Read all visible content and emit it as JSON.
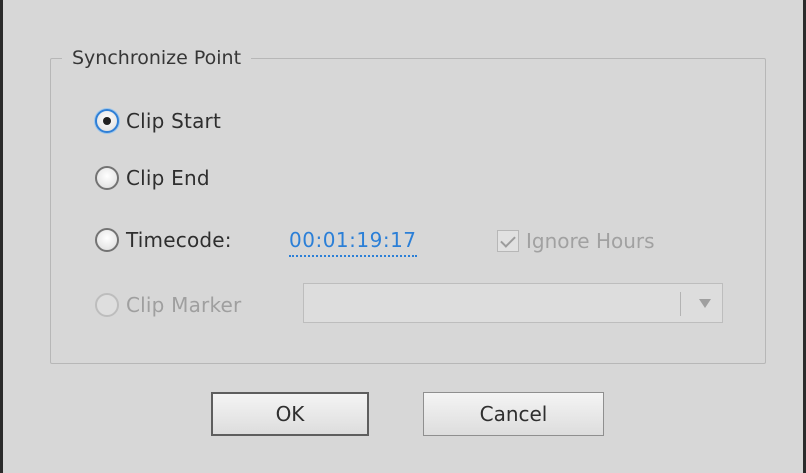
{
  "dialog": {
    "group_title": "Synchronize Point",
    "options": {
      "clip_start": "Clip Start",
      "clip_end": "Clip End",
      "timecode": "Timecode:",
      "clip_marker": "Clip Marker"
    },
    "selected_option": "Clip Start",
    "timecode_value": "00:01:19:17",
    "ignore_hours": {
      "label": "Ignore Hours",
      "checked": true,
      "enabled": false
    },
    "clip_marker_select": {
      "value": "",
      "enabled": false
    },
    "buttons": {
      "ok": "OK",
      "cancel": "Cancel"
    }
  },
  "colors": {
    "dialog_background": "#d7d7d7",
    "accent_blue": "#2b7fd7",
    "disabled_text": "#9f9f9f"
  },
  "icons": [
    "radio-selected-icon",
    "radio-unselected-icon",
    "checkbox-checked-icon",
    "dropdown-arrow-icon"
  ]
}
